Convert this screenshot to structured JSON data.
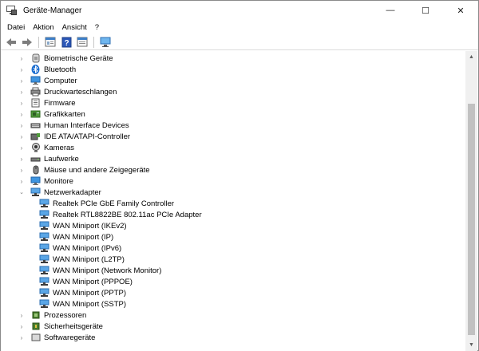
{
  "window": {
    "title": "Geräte-Manager",
    "minimize": "—",
    "maximize": "☐",
    "close": "✕"
  },
  "menu": [
    {
      "label": "Datei"
    },
    {
      "label": "Aktion"
    },
    {
      "label": "Ansicht"
    },
    {
      "label": "?"
    }
  ],
  "toolbar": [
    "back-icon",
    "forward-icon",
    "properties-icon",
    "help-icon",
    "view-icon",
    "monitor-icon"
  ],
  "tree": {
    "top_items": [
      {
        "label": "Biometrische Geräte",
        "icon": "biometric-icon"
      },
      {
        "label": "Bluetooth",
        "icon": "bluetooth-icon"
      },
      {
        "label": "Computer",
        "icon": "computer-icon"
      },
      {
        "label": "Druckwarteschlangen",
        "icon": "printer-icon"
      },
      {
        "label": "Firmware",
        "icon": "firmware-icon"
      },
      {
        "label": "Grafikkarten",
        "icon": "display-adapter-icon"
      },
      {
        "label": "Human Interface Devices",
        "icon": "hid-icon"
      },
      {
        "label": "IDE ATA/ATAPI-Controller",
        "icon": "ide-icon"
      },
      {
        "label": "Kameras",
        "icon": "camera-icon"
      },
      {
        "label": "Laufwerke",
        "icon": "drive-icon"
      },
      {
        "label": "Mäuse und andere Zeigegeräte",
        "icon": "mouse-icon"
      },
      {
        "label": "Monitore",
        "icon": "monitor-icon"
      }
    ],
    "network": {
      "label": "Netzwerkadapter",
      "icon": "network-icon",
      "children": [
        "Realtek PCIe GbE Family Controller",
        "Realtek RTL8822BE 802.11ac PCIe Adapter",
        "WAN Miniport (IKEv2)",
        "WAN Miniport (IP)",
        "WAN Miniport (IPv6)",
        "WAN Miniport (L2TP)",
        "WAN Miniport (Network Monitor)",
        "WAN Miniport (PPPOE)",
        "WAN Miniport (PPTP)",
        "WAN Miniport (SSTP)"
      ]
    },
    "bottom_items": [
      {
        "label": "Prozessoren",
        "icon": "processor-icon"
      },
      {
        "label": "Sicherheitsgeräte",
        "icon": "security-icon"
      },
      {
        "label": "Softwaregeräte",
        "icon": "software-icon"
      }
    ]
  },
  "colors": {
    "accent": "#2a7fd4",
    "network_icon": "#3c8fd6"
  }
}
